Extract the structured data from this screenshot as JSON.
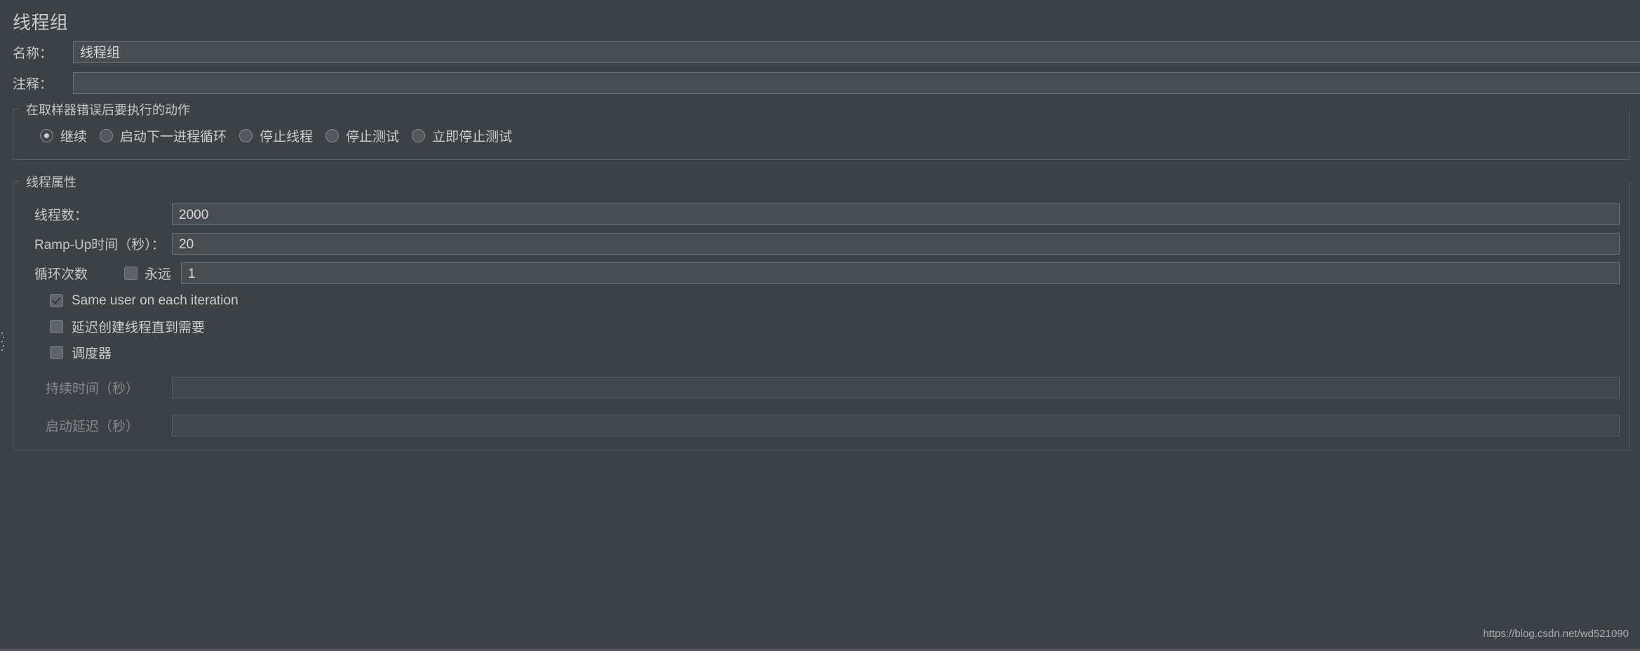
{
  "window": {
    "title": "线程组",
    "watermark": "https://blog.csdn.net/wd521090",
    "accent_color": "#3c4145",
    "text_color": "#c9cdd0"
  },
  "header": {
    "name_label": "名称：",
    "name_value": "线程组",
    "comment_label": "注释：",
    "comment_value": ""
  },
  "error_action": {
    "legend": "在取样器错误后要执行的动作",
    "options": [
      {
        "label": "继续",
        "selected": true
      },
      {
        "label": "启动下一进程循环",
        "selected": false
      },
      {
        "label": "停止线程",
        "selected": false
      },
      {
        "label": "停止测试",
        "selected": false
      },
      {
        "label": "立即停止测试",
        "selected": false
      }
    ]
  },
  "thread_properties": {
    "legend": "线程属性",
    "thread_count_label": "线程数：",
    "thread_count_value": "2000",
    "ramp_up_label": "Ramp-Up时间（秒）：",
    "ramp_up_value": "20",
    "loop_count_label": "循环次数",
    "forever_label": "永远",
    "forever_checked": false,
    "loop_count_value": "1",
    "same_user_label": "Same user on each iteration",
    "same_user_checked": true,
    "delay_create_label": "延迟创建线程直到需要",
    "delay_create_checked": false,
    "scheduler_label": "调度器",
    "scheduler_checked": false,
    "duration_label": "持续时间（秒）",
    "duration_value": "",
    "startup_delay_label": "启动延迟（秒）",
    "startup_delay_value": ""
  }
}
